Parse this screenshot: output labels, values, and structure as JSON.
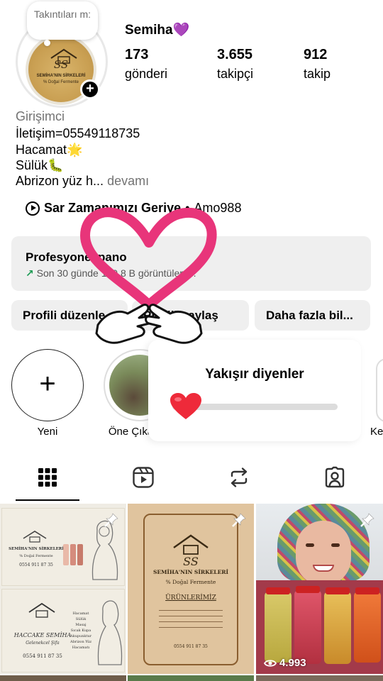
{
  "note": {
    "text": "Takıntıları m:"
  },
  "avatar": {
    "logo_initials": "SS",
    "logo_line1": "SEMİHA'NIN SİRKELERİ",
    "logo_line2": "% Doğal Fermente"
  },
  "profile": {
    "username": "Semiha",
    "username_emoji": "💜",
    "stats": [
      {
        "value": "173",
        "label": "gönderi"
      },
      {
        "value": "3.655",
        "label": "takipçi"
      },
      {
        "value": "912",
        "label": "takip"
      }
    ]
  },
  "bio": {
    "category": "Girişimci",
    "line1": "İletişim=05549118735",
    "line2": "Hacamat🌟",
    "line3": "Sülük🐛",
    "line4": "Abrizon yüz h...",
    "more": "devamı"
  },
  "music": {
    "title": "Sar Zamanımızı Geriye",
    "separator": "•",
    "artist": "Amo988"
  },
  "dashboard": {
    "title": "Profesyonel pano",
    "subtitle": "Son 30 günde 140,8 B görüntüleme.",
    "arrow": "↗"
  },
  "buttons": {
    "edit": "Profili düzenle",
    "share": "Profili paylaş",
    "more": "Daha fazla bil..."
  },
  "highlights": [
    {
      "label": "Yeni"
    },
    {
      "label": "Öne Çıkanlar"
    },
    {
      "label": "Ke"
    }
  ],
  "popup": {
    "title": "Yakışır diyenler",
    "progress": 0.1
  },
  "tabs": [
    {
      "icon": "grid-icon",
      "active": true
    },
    {
      "icon": "reels-icon",
      "active": false
    },
    {
      "icon": "reposts-icon",
      "active": false
    },
    {
      "icon": "tagged-icon",
      "active": false
    }
  ],
  "posts": {
    "tile1_top_name": "SEMİHA'NIN SİRKELERİ",
    "tile1_top_sub": "% Doğal Fermente",
    "tile1_top_phone": "0554 911 87 35",
    "tile1_bottom_name": "HACCAKE SEMİHA",
    "tile1_bottom_sub": "Gelenekcel Şifa",
    "tile1_bottom_phone": "0554 911 87 35",
    "tile1_list": [
      "Hacamat",
      "Sülük",
      "Masaj",
      "Sıcak Kupa",
      "Akupunktur",
      "Abrizon Yüz Hacamatı"
    ],
    "tile2_name": "SEMİHA'NIN SİRKELERİ",
    "tile2_sub": "% Doğal Fermente",
    "tile2_heading": "ÜRÜNLERİMİZ",
    "tile2_phone": "0554 911 87 35",
    "tile3_views": "4.993"
  },
  "colors": {
    "heart": "#e8357a",
    "accent_green": "#1a9a52",
    "button_bg": "#efefef"
  }
}
